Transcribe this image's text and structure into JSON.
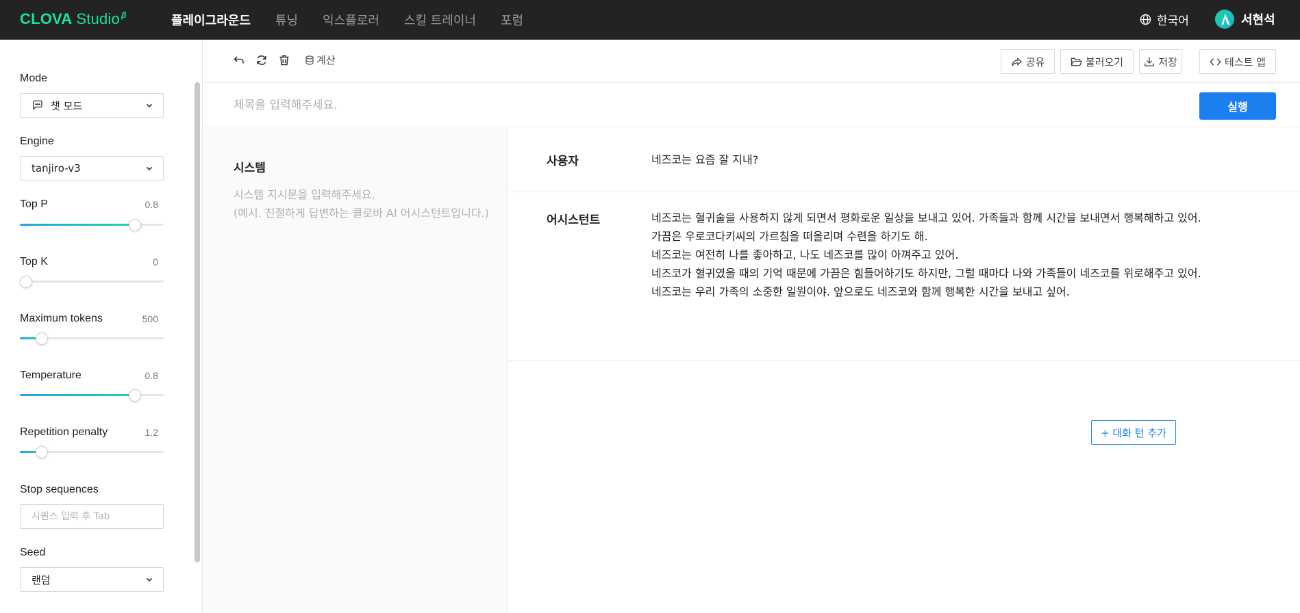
{
  "brand": {
    "name": "CLOVA",
    "product": "Studio",
    "beta": "β"
  },
  "nav": {
    "items": [
      "플레이그라운드",
      "튜닝",
      "익스플로러",
      "스킬 트레이너",
      "포럼"
    ],
    "active_index": 0
  },
  "language": {
    "label": "한국어"
  },
  "user": {
    "name": "서현석"
  },
  "sidebar": {
    "mode": {
      "label": "Mode",
      "value": "챗 모드"
    },
    "engine": {
      "label": "Engine",
      "value": "tanjiro-v3"
    },
    "top_p": {
      "label": "Top P",
      "value": "0.8",
      "fraction": 0.8
    },
    "top_k": {
      "label": "Top K",
      "value": "0",
      "fraction": 0.0
    },
    "max_tokens": {
      "label": "Maximum tokens",
      "value": "500",
      "fraction": 0.15
    },
    "temperature": {
      "label": "Temperature",
      "value": "0.8",
      "fraction": 0.8
    },
    "repetition_penalty": {
      "label": "Repetition penalty",
      "value": "1.2",
      "fraction": 0.15
    },
    "stop_sequences": {
      "label": "Stop sequences",
      "placeholder": "시퀀스 입력 후 Tab"
    },
    "seed": {
      "label": "Seed",
      "value": "랜덤"
    }
  },
  "toolbar": {
    "calc_label": "계산",
    "share_label": "공유",
    "load_label": "불러오기",
    "save_label": "저장",
    "test_app_label": "테스트 앱"
  },
  "title": {
    "placeholder": "제목을 입력해주세요."
  },
  "run_label": "실행",
  "system": {
    "title": "시스템",
    "placeholder": "시스템 지시문을 입력해주세요.\n(예시. 친절하게 답변하는 클로바 AI 어시스턴트입니다.)"
  },
  "chat": {
    "user_role": "사용자",
    "user_message": "네즈코는 요즘 잘 지내?",
    "assistant_role": "어시스턴트",
    "assistant_message": "네즈코는 혈귀술을 사용하지 않게 되면서 평화로운 일상을 보내고 있어. 가족들과 함께 시간을 보내면서 행복해하고 있어.\n가끔은 우로코다키씨의 가르침을 떠올리며 수련을 하기도 해.\n네즈코는 여전히 나를 좋아하고, 나도 네즈코를 많이 아껴주고 있어.\n네즈코가 혈귀였을 때의 기억 때문에 가끔은 힘들어하기도 하지만, 그럴 때마다 나와 가족들이 네즈코를 위로해주고 있어.\n네즈코는 우리 가족의 소중한 일원이야. 앞으로도 네즈코와 함께 행복한 시간을 보내고 싶어.",
    "add_turn_label": "+ 대화 턴 추가"
  },
  "colors": {
    "accent": "#1c7ff0",
    "brand": "#17e2a6",
    "nav_bg": "#232323"
  }
}
